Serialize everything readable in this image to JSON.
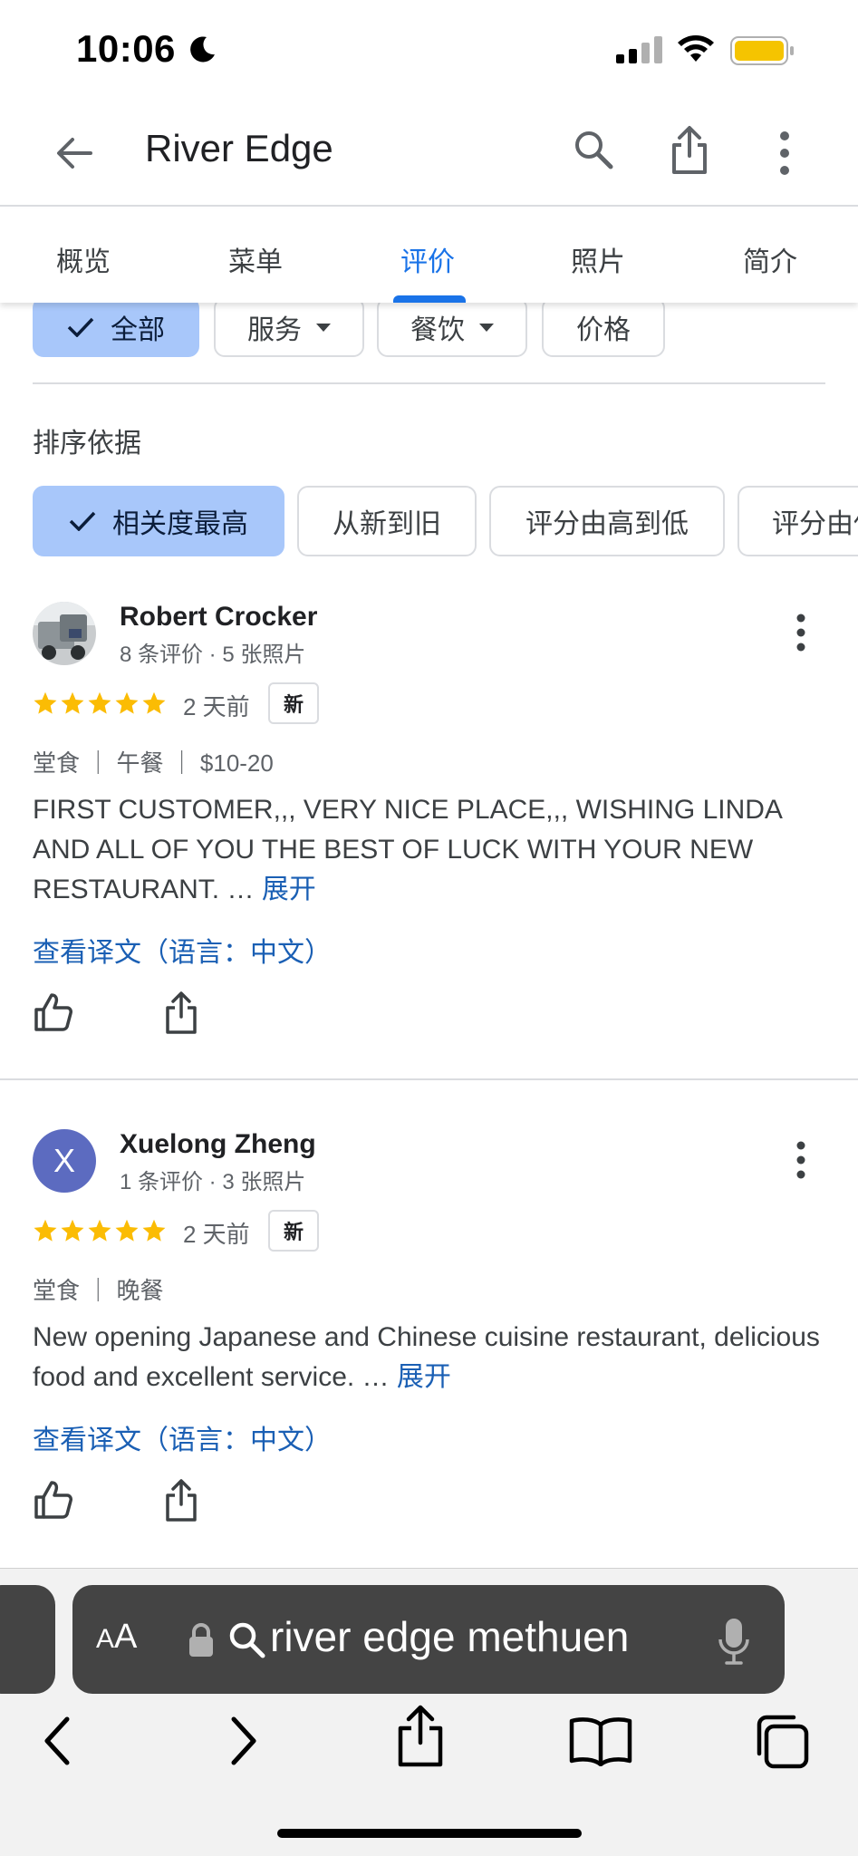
{
  "status_bar": {
    "time": "10:06"
  },
  "app_bar": {
    "title": "River Edge"
  },
  "tabs": [
    {
      "label": "概览"
    },
    {
      "label": "菜单"
    },
    {
      "label": "评价"
    },
    {
      "label": "照片"
    },
    {
      "label": "简介"
    }
  ],
  "active_tab": "评价",
  "filter_chips": [
    {
      "label": "全部",
      "selected": true
    },
    {
      "label": "服务",
      "selected": false
    },
    {
      "label": "餐饮",
      "selected": false
    },
    {
      "label": "价格",
      "selected": false
    }
  ],
  "sort": {
    "label": "排序依据",
    "options": [
      {
        "label": "相关度最高",
        "selected": true
      },
      {
        "label": "从新到旧",
        "selected": false
      },
      {
        "label": "评分由高到低",
        "selected": false
      },
      {
        "label": "评分由低到高",
        "selected": false
      }
    ]
  },
  "reviews": [
    {
      "name": "Robert Crocker",
      "meta": "8 条评价 · 5 张照片",
      "rating": 5,
      "time": "2 天前",
      "badge": "新",
      "tags": "堂食 ｜ 午餐 ｜ $10-20",
      "text": "FIRST CUSTOMER,,, VERY NICE PLACE,,, WISHING LINDA AND ALL OF YOU THE BEST OF LUCK WITH YOUR NEW RESTAURANT. …",
      "expand": "展开",
      "translate": "查看译文（语言：中文）"
    },
    {
      "name": "Xuelong Zheng",
      "initial": "X",
      "meta": "1 条评价 · 3 张照片",
      "rating": 5,
      "time": "2 天前",
      "badge": "新",
      "tags": "堂食 ｜ 晚餐",
      "text": "New opening Japanese and Chinese cuisine restaurant, delicious food and excellent service. …",
      "expand": "展开",
      "translate": "查看译文（语言：中文）"
    }
  ],
  "browser": {
    "aa_label_big": "A",
    "aa_label_small": "A",
    "url_text": "river edge methuen"
  },
  "colors": {
    "accent": "#1a73e8",
    "chip_selected": "#a8c7fa",
    "star": "#fbbc04",
    "link": "#1a5fb4"
  }
}
